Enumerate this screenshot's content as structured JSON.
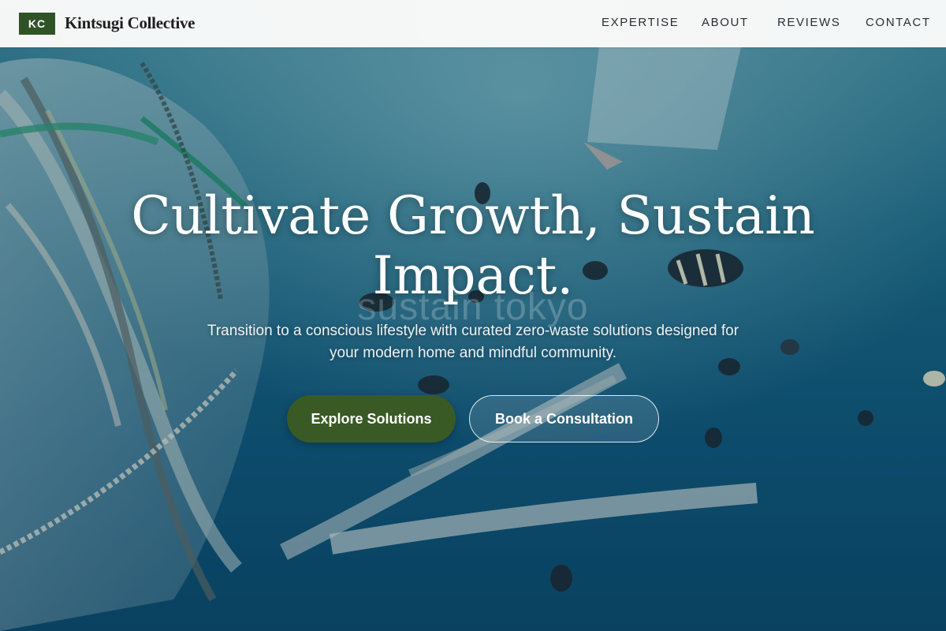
{
  "header": {
    "logo_badge": "KC",
    "brand_name": "Kintsugi Collective",
    "nav": [
      "EXPERTISE",
      "ABOUT",
      "REVIEWS",
      "CONTACT"
    ]
  },
  "hero": {
    "title": "Cultivate Growth, Sustain Impact.",
    "subtitle": "Transition to a conscious lifestyle with curated zero-waste solutions designed for your modern home and mindful community.",
    "watermark": "sustain tokyo",
    "primary_button": "Explore Solutions",
    "secondary_button": "Book a Consultation",
    "background_image": "underwater-plastic-pollution-with-fish"
  },
  "colors": {
    "brand_green": "#2f5326",
    "button_green": "#3a5a25",
    "ocean_blue": "#0d4a66",
    "header_bg": "#fcfcfb"
  }
}
